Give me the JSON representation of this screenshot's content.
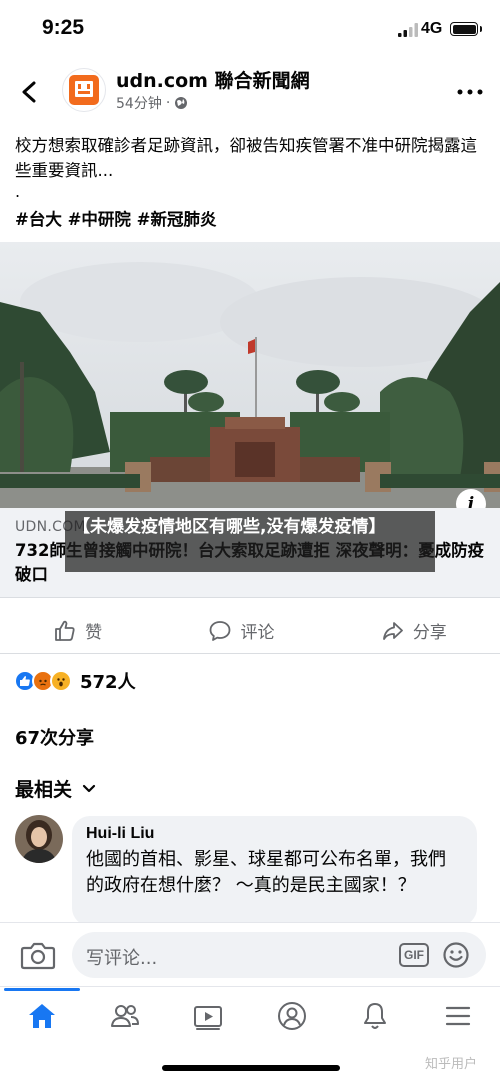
{
  "status_bar": {
    "time": "9:25",
    "network": "4G"
  },
  "post": {
    "page_name": "udn.com 聯合新聞網",
    "time_ago": "54分钟",
    "separator": "·",
    "text": "校方想索取確診者足跡資訊，卻被告知疾管署不准中研院揭露這些重要資訊...",
    "dot": ".",
    "hashtags": "#台大 #中研院 #新冠肺炎"
  },
  "link_preview": {
    "domain": "UDN.COM",
    "title": "732師生曾接觸中研院！台大索取足跡遭拒 深夜聲明：憂成防疫破口"
  },
  "overlay": {
    "title": "【未爆发疫情地区有哪些,没有爆发疫情】"
  },
  "actions": {
    "like": "赞",
    "comment": "评论",
    "share": "分享"
  },
  "reactions": {
    "count": "572人",
    "types": [
      "like-icon",
      "angry-icon",
      "wow-icon"
    ]
  },
  "shares": "67次分享",
  "comments_sort": "最相关",
  "comment": {
    "author": "Hui-li Liu",
    "text": "他國的首相、影星、球星都可公布名單，我們的政府在想什麼？ ～真的是民主國家！？"
  },
  "comment_input": {
    "placeholder": "写评论...",
    "gif": "GIF"
  },
  "bottom_nav": [
    "home-icon",
    "friends-icon",
    "watch-icon",
    "profile-icon",
    "notifications-icon",
    "menu-icon"
  ],
  "watermark": "知乎用户",
  "colors": {
    "accent": "#1877f2",
    "secondary_text": "#65676b",
    "bubble": "#f0f2f5",
    "udn_brand": "#f26b1d"
  }
}
